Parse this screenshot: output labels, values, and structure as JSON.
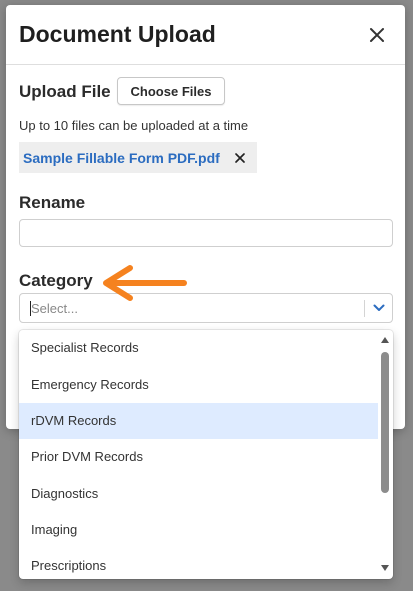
{
  "modal": {
    "title": "Document Upload",
    "close_icon": "close-icon"
  },
  "upload": {
    "label": "Upload File",
    "choose_button": "Choose Files",
    "hint": "Up to 10 files can be uploaded at a time",
    "file_name": "Sample Fillable Form PDF.pdf",
    "remove_icon": "close-icon"
  },
  "rename": {
    "label": "Rename",
    "value": ""
  },
  "category": {
    "label": "Category",
    "placeholder": "Select...",
    "chevron_icon": "chevron-down-icon",
    "annotation_icon": "arrow-left-icon",
    "options": [
      "Specialist Records",
      "Emergency Records",
      "rDVM Records",
      "Prior DVM Records",
      "Diagnostics",
      "Imaging",
      "Prescriptions"
    ],
    "highlighted_option": "rDVM Records"
  },
  "colors": {
    "accent": "#2b6cc0",
    "annotation": "#f5821f",
    "highlight": "#deebff",
    "overlay": "#8a8a8a"
  }
}
